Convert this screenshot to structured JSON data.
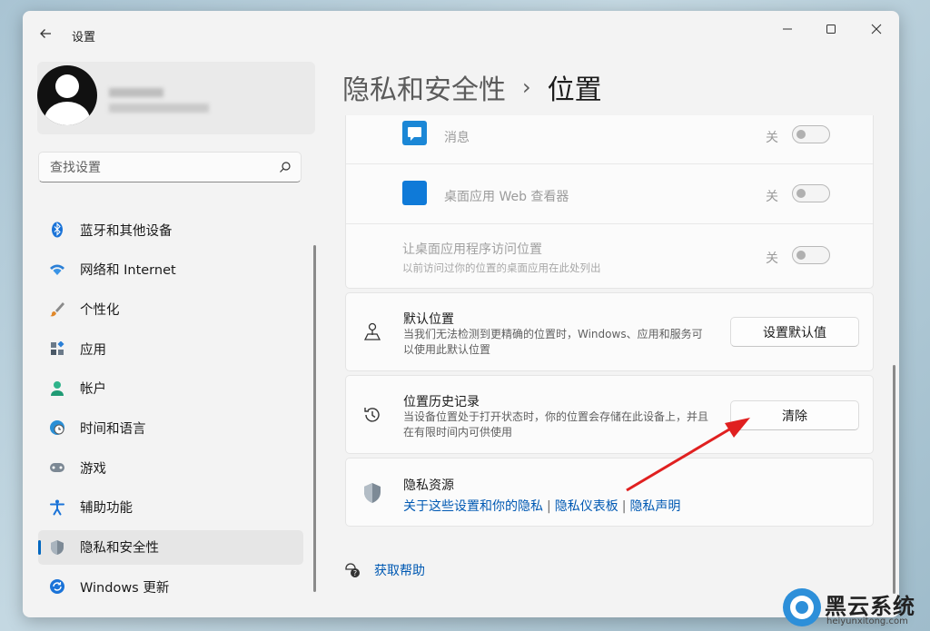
{
  "window": {
    "title": "设置"
  },
  "search": {
    "placeholder": "查找设置"
  },
  "nav": {
    "items": [
      {
        "label": "蓝牙和其他设备",
        "icon": "bluetooth-icon"
      },
      {
        "label": "网络和 Internet",
        "icon": "wifi-icon"
      },
      {
        "label": "个性化",
        "icon": "brush-icon"
      },
      {
        "label": "应用",
        "icon": "apps-icon"
      },
      {
        "label": "帐户",
        "icon": "account-icon"
      },
      {
        "label": "时间和语言",
        "icon": "clock-globe-icon"
      },
      {
        "label": "游戏",
        "icon": "gamepad-icon"
      },
      {
        "label": "辅助功能",
        "icon": "accessibility-icon"
      },
      {
        "label": "隐私和安全性",
        "icon": "shield-icon",
        "active": true
      },
      {
        "label": "Windows 更新",
        "icon": "update-icon"
      }
    ]
  },
  "breadcrumb": {
    "parent": "隐私和安全性",
    "separator": "›",
    "current": "位置"
  },
  "app_access": {
    "apps": [
      {
        "label": "消息",
        "state": "关",
        "color": "#1b87d6"
      },
      {
        "label": "桌面应用 Web 查看器",
        "state": "关",
        "color": "#0f7ad8"
      }
    ],
    "desktop_apps": {
      "title": "让桌面应用程序访问位置",
      "description": "以前访问过你的位置的桌面应用在此处列出",
      "state": "关"
    }
  },
  "default_location": {
    "title": "默认位置",
    "description": "当我们无法检测到更精确的位置时，Windows、应用和服务可以使用此默认位置",
    "button": "设置默认值"
  },
  "location_history": {
    "title": "位置历史记录",
    "description": "当设备位置处于打开状态时，你的位置会存储在此设备上，并且在有限时间内可供使用",
    "button": "清除"
  },
  "privacy_resources": {
    "title": "隐私资源",
    "links": [
      "关于这些设置和你的隐私",
      "隐私仪表板",
      "隐私声明"
    ],
    "divider": "|"
  },
  "help": {
    "label": "获取帮助"
  },
  "watermark": {
    "name": "黑云系统",
    "url": "heiyunxitong.com"
  },
  "colors": {
    "accent": "#0067c0",
    "link": "#0059b3",
    "annotation_arrow": "#e02020"
  }
}
